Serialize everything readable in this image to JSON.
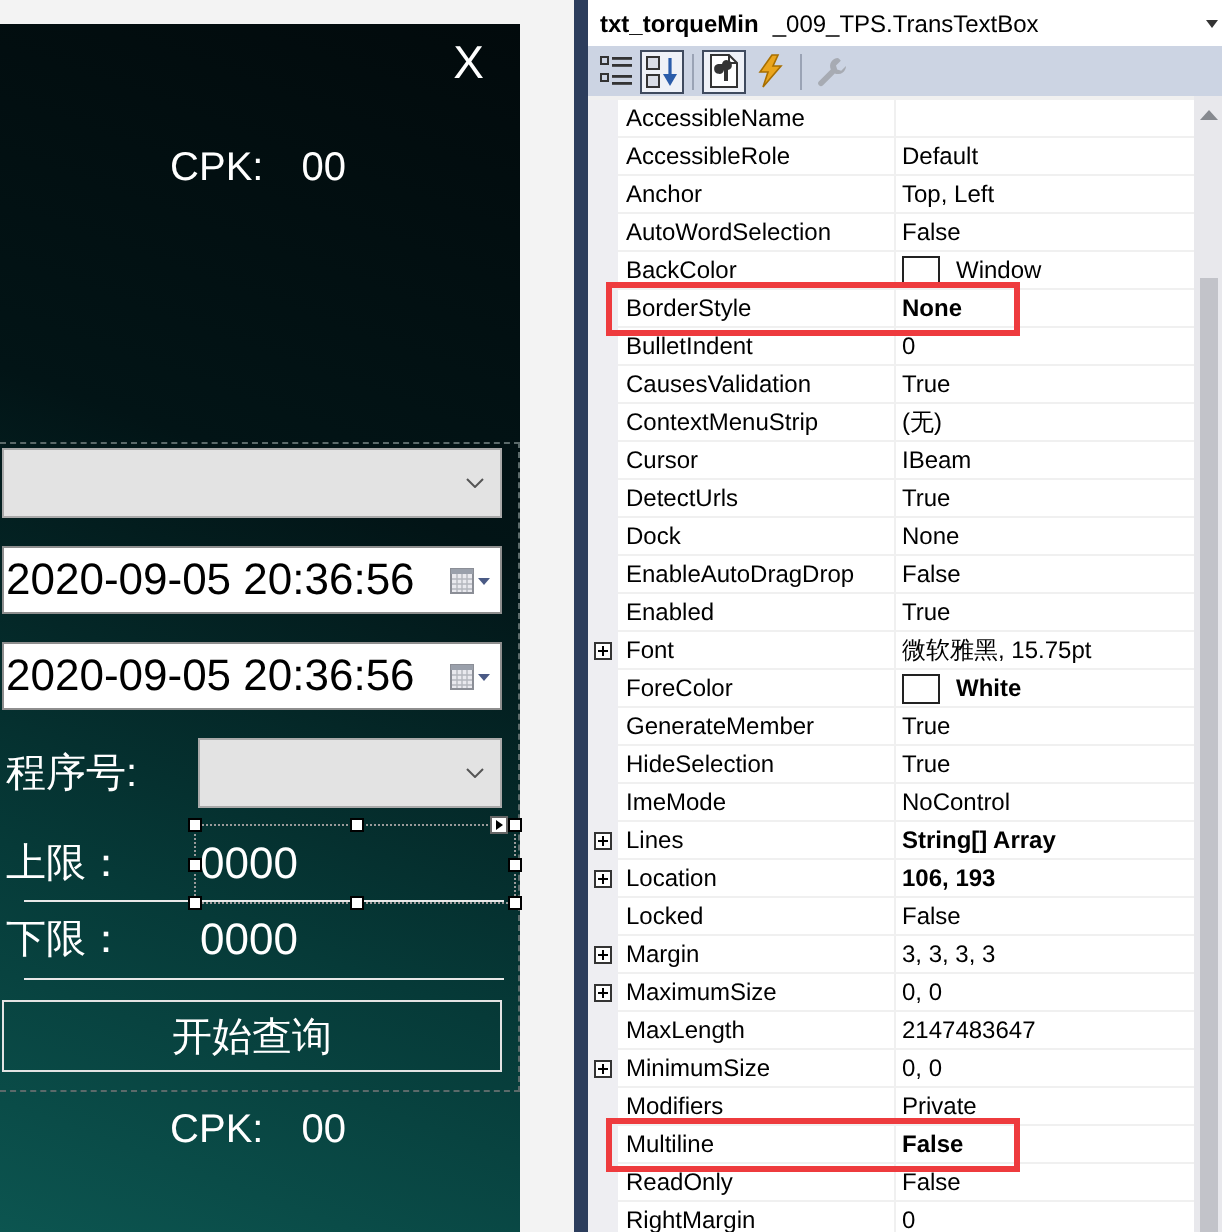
{
  "designer": {
    "close": "X",
    "cpk_top": {
      "label": "CPK:",
      "value": "00"
    },
    "fields": [
      {
        "kind": "combo"
      },
      {
        "kind": "datetime",
        "value": "2020-09-05 20:36:56"
      },
      {
        "kind": "datetime",
        "value": "2020-09-05 20:36:56"
      },
      {
        "kind": "combo",
        "label": "程序号:"
      },
      {
        "kind": "textbox",
        "label": "上限：",
        "value": "0000",
        "selected": true
      },
      {
        "kind": "textbox",
        "label": "下限：",
        "value": "0000",
        "selected": false
      }
    ],
    "query_button": "开始查询",
    "cpk_bottom": {
      "label": "CPK:",
      "value": "00"
    }
  },
  "properties": {
    "object_name": "txt_torqueMin",
    "object_type": "_009_TPS.TransTextBox",
    "toolbar": [
      {
        "buttons": [
          {
            "kind": "categorized",
            "selected": false,
            "disabled": false
          },
          {
            "kind": "alphabetical",
            "selected": true,
            "disabled": false
          }
        ]
      },
      {
        "buttons": [
          {
            "kind": "properties",
            "selected": true,
            "disabled": false
          },
          {
            "kind": "events",
            "selected": false,
            "disabled": false
          }
        ]
      },
      {
        "buttons": [
          {
            "kind": "property-pages",
            "selected": false,
            "disabled": true
          }
        ]
      }
    ],
    "rows": [
      {
        "name": "AccessibleName",
        "kind": "text",
        "expandable": false,
        "highlighted": false
      },
      {
        "name": "AccessibleRole",
        "value": "Default",
        "kind": "text",
        "modified": false,
        "expandable": false,
        "highlighted": false
      },
      {
        "name": "Anchor",
        "value": "Top, Left",
        "kind": "text",
        "modified": false,
        "expandable": false,
        "highlighted": false
      },
      {
        "name": "AutoWordSelection",
        "value": "False",
        "kind": "text",
        "modified": false,
        "expandable": false,
        "highlighted": false
      },
      {
        "name": "BackColor",
        "value": "Window",
        "kind": "color",
        "color": "#ffffff",
        "modified": false,
        "expandable": false,
        "highlighted": false
      },
      {
        "name": "BorderStyle",
        "value": "None",
        "kind": "text",
        "modified": true,
        "expandable": false,
        "highlighted": true
      },
      {
        "name": "BulletIndent",
        "value": "0",
        "kind": "text",
        "modified": false,
        "expandable": false,
        "highlighted": false
      },
      {
        "name": "CausesValidation",
        "value": "True",
        "kind": "text",
        "modified": false,
        "expandable": false,
        "highlighted": false
      },
      {
        "name": "ContextMenuStrip",
        "value": "(无)",
        "kind": "text",
        "modified": false,
        "expandable": false,
        "highlighted": false
      },
      {
        "name": "Cursor",
        "value": "IBeam",
        "kind": "text",
        "modified": false,
        "expandable": false,
        "highlighted": false
      },
      {
        "name": "DetectUrls",
        "value": "True",
        "kind": "text",
        "modified": false,
        "expandable": false,
        "highlighted": false
      },
      {
        "name": "Dock",
        "value": "None",
        "kind": "text",
        "modified": false,
        "expandable": false,
        "highlighted": false
      },
      {
        "name": "EnableAutoDragDrop",
        "value": "False",
        "kind": "text",
        "modified": false,
        "expandable": false,
        "highlighted": false
      },
      {
        "name": "Enabled",
        "value": "True",
        "kind": "text",
        "modified": false,
        "expandable": false,
        "highlighted": false
      },
      {
        "name": "Font",
        "value": "微软雅黑, 15.75pt",
        "kind": "text",
        "modified": false,
        "expandable": true,
        "highlighted": false
      },
      {
        "name": "ForeColor",
        "value": "White",
        "kind": "color",
        "color": "#ffffff",
        "modified": true,
        "expandable": false,
        "highlighted": false
      },
      {
        "name": "GenerateMember",
        "value": "True",
        "kind": "text",
        "modified": false,
        "expandable": false,
        "highlighted": false
      },
      {
        "name": "HideSelection",
        "value": "True",
        "kind": "text",
        "modified": false,
        "expandable": false,
        "highlighted": false
      },
      {
        "name": "ImeMode",
        "value": "NoControl",
        "kind": "text",
        "modified": false,
        "expandable": false,
        "highlighted": false
      },
      {
        "name": "Lines",
        "value": "String[] Array",
        "kind": "text",
        "modified": true,
        "expandable": true,
        "highlighted": false
      },
      {
        "name": "Location",
        "value": "106, 193",
        "kind": "text",
        "modified": true,
        "expandable": true,
        "highlighted": false
      },
      {
        "name": "Locked",
        "value": "False",
        "kind": "text",
        "modified": false,
        "expandable": false,
        "highlighted": false
      },
      {
        "name": "Margin",
        "value": "3, 3, 3, 3",
        "kind": "text",
        "modified": false,
        "expandable": true,
        "highlighted": false
      },
      {
        "name": "MaximumSize",
        "value": "0, 0",
        "kind": "text",
        "modified": false,
        "expandable": true,
        "highlighted": false
      },
      {
        "name": "MaxLength",
        "value": "2147483647",
        "kind": "text",
        "modified": false,
        "expandable": false,
        "highlighted": false
      },
      {
        "name": "MinimumSize",
        "value": "0, 0",
        "kind": "text",
        "modified": false,
        "expandable": true,
        "highlighted": false
      },
      {
        "name": "Modifiers",
        "value": "Private",
        "kind": "text",
        "modified": false,
        "expandable": false,
        "highlighted": false
      },
      {
        "name": "Multiline",
        "value": "False",
        "kind": "text",
        "modified": true,
        "expandable": false,
        "highlighted": true
      },
      {
        "name": "ReadOnly",
        "value": "False",
        "kind": "text",
        "modified": false,
        "expandable": false,
        "highlighted": false
      },
      {
        "name": "RightMargin",
        "value": "0",
        "kind": "text",
        "modified": false,
        "expandable": false,
        "highlighted": false
      }
    ]
  }
}
